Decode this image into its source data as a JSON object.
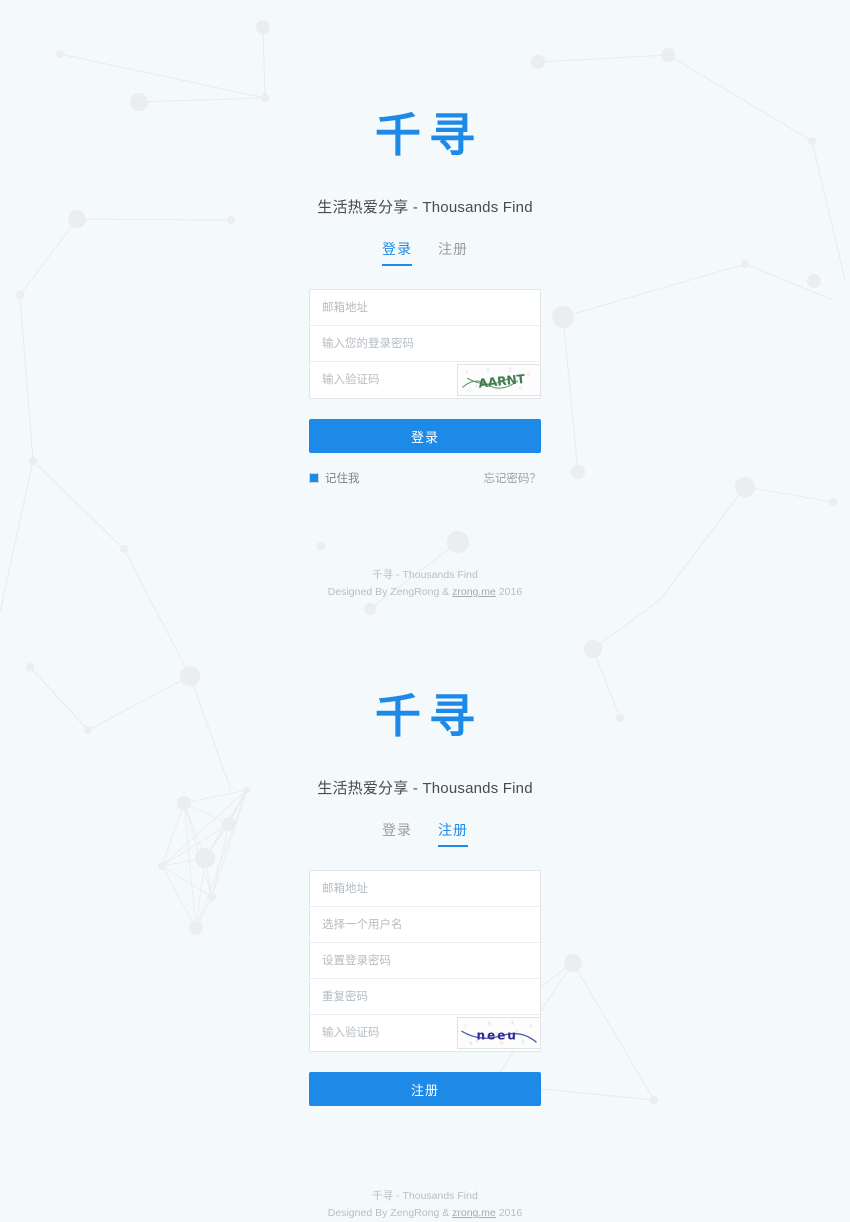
{
  "theme": {
    "brand_blue": "#1e8ae8",
    "page_background": "#f4f9fc",
    "card_background": "#ffffff",
    "placeholder_gray": "#b6bcc2"
  },
  "brand": {
    "logo_text": "千寻",
    "tagline": "生活热爱分享 - Thousands Find"
  },
  "tabs": {
    "login_label": "登录",
    "register_label": "注册"
  },
  "login_panel": {
    "active_tab": "登录",
    "fields": [
      {
        "name": "email",
        "placeholder": "邮箱地址",
        "value": "",
        "type": "text"
      },
      {
        "name": "password",
        "placeholder": "输入您的登录密码",
        "value": "",
        "type": "password"
      },
      {
        "name": "captcha",
        "placeholder": "输入验证码",
        "value": "",
        "type": "text"
      }
    ],
    "captcha": {
      "name": "login-captcha-image",
      "text": "AARNT",
      "ink_color": "#3f7d4f"
    },
    "submit_label": "登录",
    "remember_label": "记住我",
    "remember_checked": true,
    "forgot_label": "忘记密码？"
  },
  "register_panel": {
    "active_tab": "注册",
    "fields": [
      {
        "name": "email",
        "placeholder": "邮箱地址",
        "value": "",
        "type": "text"
      },
      {
        "name": "username",
        "placeholder": "选择一个用户名",
        "value": "",
        "type": "text"
      },
      {
        "name": "password",
        "placeholder": "设置登录密码",
        "value": "",
        "type": "password"
      },
      {
        "name": "password-repeat",
        "placeholder": "重复密码",
        "value": "",
        "type": "password"
      },
      {
        "name": "captcha",
        "placeholder": "输入验证码",
        "value": "",
        "type": "text"
      }
    ],
    "captcha": {
      "name": "register-captcha-image",
      "text": "neeu",
      "ink_color": "#2a2f96"
    },
    "submit_label": "注册"
  },
  "footer": {
    "line1": "千寻 - Thousands Find",
    "line2_prefix": "Designed By ZengRong & ",
    "link_text": "zrong.me",
    "line2_suffix": " 2016"
  }
}
